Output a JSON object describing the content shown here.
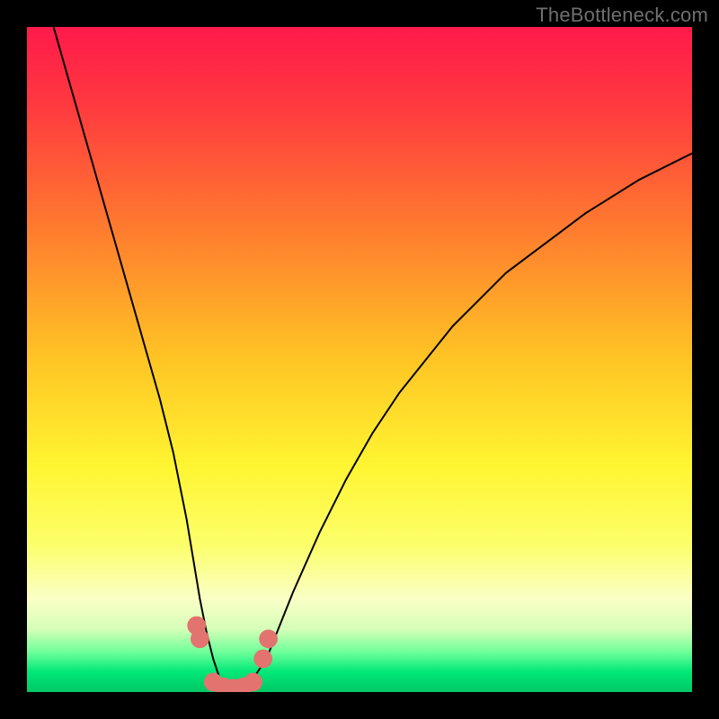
{
  "watermark": "TheBottleneck.com",
  "gradient": {
    "stops": [
      {
        "offset": 0.0,
        "color": "#ff1a4b"
      },
      {
        "offset": 0.12,
        "color": "#ff3a3f"
      },
      {
        "offset": 0.3,
        "color": "#ff7a2f"
      },
      {
        "offset": 0.5,
        "color": "#ffc524"
      },
      {
        "offset": 0.66,
        "color": "#fff531"
      },
      {
        "offset": 0.78,
        "color": "#fcff6b"
      },
      {
        "offset": 0.86,
        "color": "#faffc6"
      },
      {
        "offset": 0.905,
        "color": "#d6ffb8"
      },
      {
        "offset": 0.94,
        "color": "#6fff9a"
      },
      {
        "offset": 0.97,
        "color": "#00e877"
      },
      {
        "offset": 1.0,
        "color": "#00c765"
      }
    ]
  },
  "marker_color": "#e2736e",
  "curve_color": "#000000",
  "chart_data": {
    "type": "line",
    "title": "",
    "xlabel": "",
    "ylabel": "",
    "xlim": [
      0,
      100
    ],
    "ylim": [
      0,
      100
    ],
    "series": [
      {
        "name": "bottleneck-curve",
        "x": [
          4,
          6,
          8,
          10,
          12,
          14,
          16,
          18,
          20,
          22,
          24,
          25,
          26,
          27,
          28,
          29,
          30,
          31,
          32,
          33,
          34,
          36,
          38,
          40,
          44,
          48,
          52,
          56,
          60,
          64,
          68,
          72,
          76,
          80,
          84,
          88,
          92,
          96,
          100
        ],
        "y": [
          100,
          93,
          86,
          79,
          72,
          65,
          58,
          51,
          44,
          36,
          26,
          20,
          14,
          9,
          5,
          2,
          1,
          0.5,
          0.5,
          1,
          2,
          5,
          10,
          15,
          24,
          32,
          39,
          45,
          50,
          55,
          59,
          63,
          66,
          69,
          72,
          74.5,
          77,
          79,
          81
        ]
      }
    ],
    "markers": {
      "x": [
        25.5,
        26.0,
        28.0,
        29.5,
        31.0,
        32.5,
        34.0,
        35.5,
        36.3
      ],
      "y": [
        10.0,
        8.0,
        1.5,
        0.8,
        0.6,
        0.8,
        1.5,
        5.0,
        8.0
      ],
      "r": 1.4
    }
  }
}
